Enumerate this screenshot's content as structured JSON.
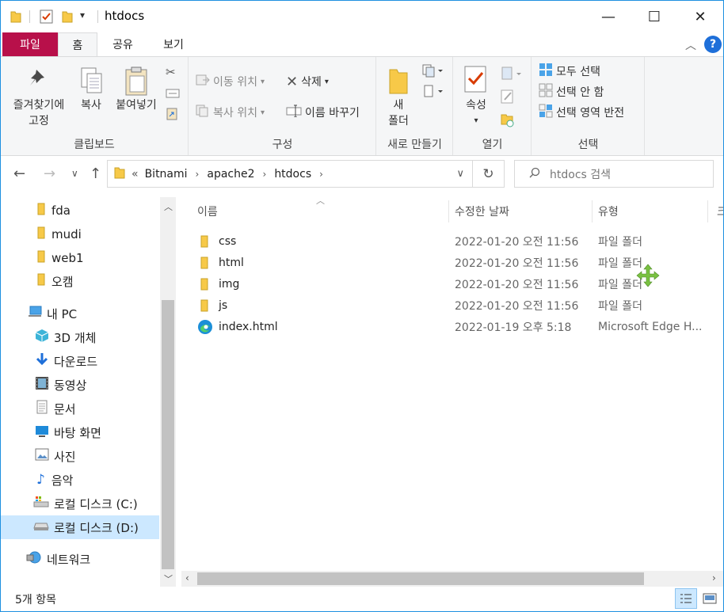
{
  "window": {
    "title": "htdocs",
    "controls": {
      "minimize": "—",
      "maximize": "☐",
      "close": "✕"
    }
  },
  "quick_access": {
    "customize": "▾"
  },
  "ribbon_tabs": [
    {
      "label": "파일"
    },
    {
      "label": "홈"
    },
    {
      "label": "공유"
    },
    {
      "label": "보기"
    }
  ],
  "ribbon": {
    "clipboard": {
      "label": "클립보드",
      "pin_line1": "즐겨찾기에",
      "pin_line2": "고정",
      "copy": "복사",
      "paste": "붙여넣기"
    },
    "organize": {
      "label": "구성",
      "move_to": "이동 위치",
      "copy_to": "복사 위치",
      "delete": "삭제",
      "rename": "이름 바꾸기"
    },
    "new": {
      "label": "새로 만들기",
      "new_folder_line1": "새",
      "new_folder_line2": "폴더"
    },
    "open": {
      "label": "열기",
      "properties": "속성"
    },
    "select": {
      "label": "선택",
      "select_all": "모두 선택",
      "select_none": "선택 안 함",
      "invert": "선택 영역 반전"
    },
    "help": "?"
  },
  "address": {
    "overflow": "«",
    "crumbs": [
      "Bitnami",
      "apache2",
      "htdocs"
    ],
    "search_placeholder": "htdocs 검색"
  },
  "nav": {
    "quick": [
      {
        "label": "fda"
      },
      {
        "label": "mudi"
      },
      {
        "label": "web1"
      },
      {
        "label": "오캠"
      }
    ],
    "pc_label": "내 PC",
    "pc_items": [
      {
        "label": "3D 개체",
        "icon": "cube-icon"
      },
      {
        "label": "다운로드",
        "icon": "download-icon"
      },
      {
        "label": "동영상",
        "icon": "video-icon"
      },
      {
        "label": "문서",
        "icon": "document-icon"
      },
      {
        "label": "바탕 화면",
        "icon": "desktop-icon"
      },
      {
        "label": "사진",
        "icon": "picture-icon"
      },
      {
        "label": "음악",
        "icon": "music-icon"
      },
      {
        "label": "로컬 디스크 (C:)",
        "icon": "drive-c-icon"
      },
      {
        "label": "로컬 디스크 (D:)",
        "icon": "drive-d-icon",
        "selected": true
      }
    ],
    "network_label": "네트워크"
  },
  "columns": {
    "name": "이름",
    "modified": "수정한 날짜",
    "type": "유형",
    "size": "크"
  },
  "files": [
    {
      "name": "css",
      "modified": "2022-01-20 오전 11:56",
      "type": "파일 폴더",
      "kind": "folder"
    },
    {
      "name": "html",
      "modified": "2022-01-20 오전 11:56",
      "type": "파일 폴더",
      "kind": "folder"
    },
    {
      "name": "img",
      "modified": "2022-01-20 오전 11:56",
      "type": "파일 폴더",
      "kind": "folder"
    },
    {
      "name": "js",
      "modified": "2022-01-20 오전 11:56",
      "type": "파일 폴더",
      "kind": "folder"
    },
    {
      "name": "index.html",
      "modified": "2022-01-19 오후 5:18",
      "type": "Microsoft Edge H...",
      "kind": "edge"
    }
  ],
  "status": {
    "count": "5개 항목"
  },
  "colors": {
    "file_tab": "#b8104a",
    "selection": "#cce8ff",
    "folder": "#f7c948",
    "accent": "#1e90e0",
    "move_cursor": "#7ac142"
  }
}
